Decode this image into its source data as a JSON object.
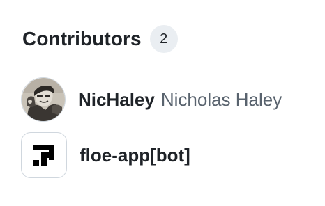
{
  "section": {
    "title": "Contributors",
    "count": "2"
  },
  "contributors": [
    {
      "login": "NicHaley",
      "full_name": "Nicholas Haley",
      "avatar_icon": "photo-avatar"
    },
    {
      "login": "floe-app[bot]",
      "full_name": "",
      "avatar_icon": "floe-logo-icon"
    }
  ],
  "colors": {
    "text_primary": "#1f2328",
    "text_secondary": "#59636e",
    "counter_bg": "#eaeef2",
    "border": "#d0d7de"
  }
}
